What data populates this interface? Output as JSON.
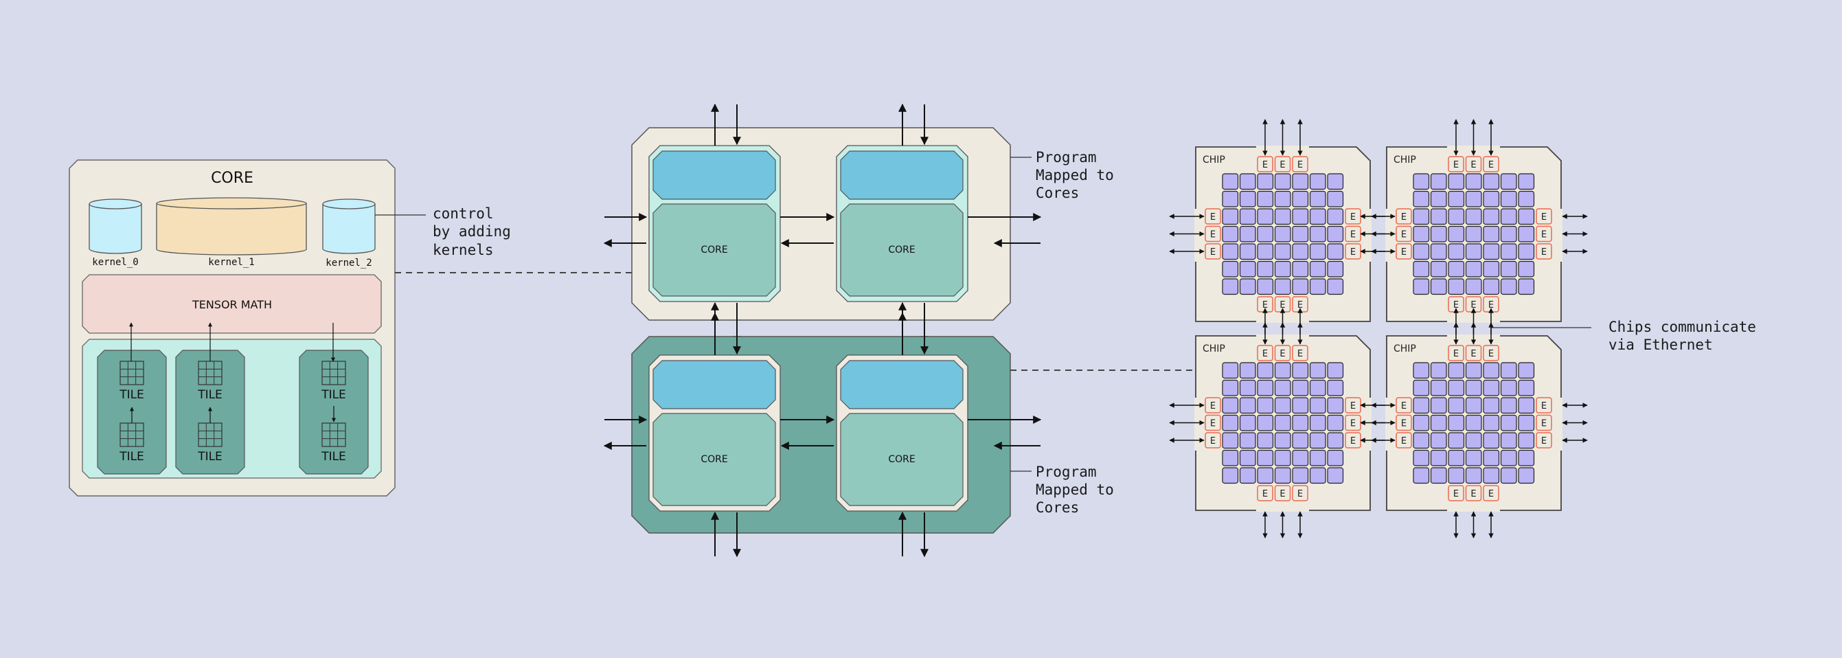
{
  "colors": {
    "background": "#d8dbec",
    "panel": "#eeeae0",
    "outline": "#555555",
    "kernel_small": "#c5effb",
    "kernel_large": "#f5e0ba",
    "tensor_math": "#f2d8d2",
    "tile_area": "#c5eee6",
    "tile_group": "#6eaaa0",
    "sram_block": "#72c4df",
    "core_block": "#92c9bf",
    "core_frame_light": "#c5eee6",
    "cluster_dark": "#6eaaa0",
    "chip_cell": "#bab3f4",
    "eth_border": "#ec6a4e"
  },
  "core_panel": {
    "title": "CORE",
    "kernels": [
      {
        "label": "kernel_0"
      },
      {
        "label": "kernel_1"
      },
      {
        "label": "kernel_2"
      }
    ],
    "tensor_math_label": "TENSOR MATH",
    "tile_label": "TILE",
    "tile_groups": [
      {
        "tiles": [
          "TILE",
          "TILE"
        ],
        "flow": "up"
      },
      {
        "tiles": [
          "TILE",
          "TILE"
        ],
        "flow": "up"
      },
      {
        "tiles": [
          "TILE",
          "TILE"
        ],
        "flow": "down"
      }
    ]
  },
  "annotations": {
    "control": [
      "control",
      "by adding",
      "kernels"
    ],
    "program_top": [
      "Program",
      "Mapped to",
      "Cores"
    ],
    "program_bottom": [
      "Program",
      "Mapped to",
      "Cores"
    ],
    "chips": [
      "Chips communicate",
      "via Ethernet"
    ]
  },
  "clusters": [
    {
      "variant": "light",
      "cores": [
        {
          "label": "CORE"
        },
        {
          "label": "CORE"
        }
      ]
    },
    {
      "variant": "dark",
      "cores": [
        {
          "label": "CORE"
        },
        {
          "label": "CORE"
        }
      ]
    }
  ],
  "chips": [
    {
      "label": "CHIP",
      "eth_label": "E",
      "grid": {
        "rows": 7,
        "cols": 7
      }
    },
    {
      "label": "CHIP",
      "eth_label": "E",
      "grid": {
        "rows": 7,
        "cols": 7
      }
    },
    {
      "label": "CHIP",
      "eth_label": "E",
      "grid": {
        "rows": 7,
        "cols": 7
      }
    },
    {
      "label": "CHIP",
      "eth_label": "E",
      "grid": {
        "rows": 7,
        "cols": 7
      }
    }
  ]
}
